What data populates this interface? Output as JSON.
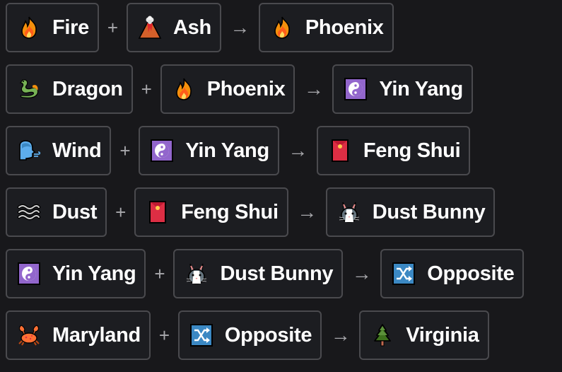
{
  "recipes": [
    {
      "first": {
        "name": "Fire",
        "icon": "fire"
      },
      "operator": "+",
      "second": {
        "name": "Ash",
        "icon": "volcano"
      },
      "arrow": "→",
      "result": {
        "name": "Phoenix",
        "icon": "fire"
      }
    },
    {
      "first": {
        "name": "Dragon",
        "icon": "dragon"
      },
      "operator": "+",
      "second": {
        "name": "Phoenix",
        "icon": "fire"
      },
      "arrow": "→",
      "result": {
        "name": "Yin Yang",
        "icon": "yin-yang"
      }
    },
    {
      "first": {
        "name": "Wind",
        "icon": "wind-face"
      },
      "operator": "+",
      "second": {
        "name": "Yin Yang",
        "icon": "yin-yang"
      },
      "arrow": "→",
      "result": {
        "name": "Feng Shui",
        "icon": "red-envelope"
      }
    },
    {
      "first": {
        "name": "Dust",
        "icon": "fog-waves"
      },
      "operator": "+",
      "second": {
        "name": "Feng Shui",
        "icon": "red-envelope"
      },
      "arrow": "→",
      "result": {
        "name": "Dust Bunny",
        "icon": "rabbit-face"
      }
    },
    {
      "first": {
        "name": "Yin Yang",
        "icon": "yin-yang"
      },
      "operator": "+",
      "second": {
        "name": "Dust Bunny",
        "icon": "rabbit-face"
      },
      "arrow": "→",
      "result": {
        "name": "Opposite",
        "icon": "shuffle"
      }
    },
    {
      "first": {
        "name": "Maryland",
        "icon": "crab"
      },
      "operator": "+",
      "second": {
        "name": "Opposite",
        "icon": "shuffle"
      },
      "arrow": "→",
      "result": {
        "name": "Virginia",
        "icon": "evergreen-tree"
      }
    }
  ],
  "colors": {
    "background": "#18181b",
    "item_background": "#1c1d21",
    "item_border": "#4a4a4e",
    "text": "#ffffff",
    "operator": "#a8a8ac"
  }
}
